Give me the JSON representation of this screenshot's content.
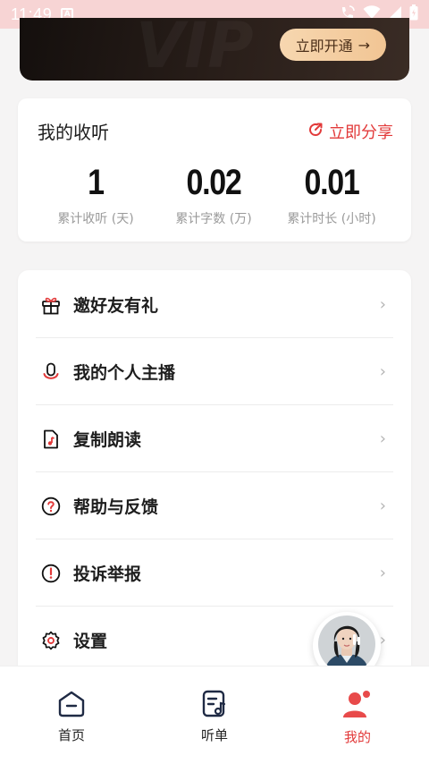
{
  "status_bar": {
    "time": "11:49",
    "notification_icon": "a-icon",
    "indicators": [
      "call-wifi-icon",
      "wifi-icon",
      "signal-icon",
      "battery-icon"
    ]
  },
  "vip_banner": {
    "button_label": "立即开通",
    "button_arrow": "→"
  },
  "listening": {
    "title": "我的收听",
    "share_label": "立即分享",
    "stats": [
      {
        "value": "1",
        "label": "累计收听 (天)"
      },
      {
        "value": "0.02",
        "label": "累计字数 (万)"
      },
      {
        "value": "0.01",
        "label": "累计时长 (小时)"
      }
    ]
  },
  "menu": {
    "items": [
      {
        "label": "邀好友有礼",
        "icon": "gift-icon"
      },
      {
        "label": "我的个人主播",
        "icon": "microphone-icon"
      },
      {
        "label": "复制朗读",
        "icon": "document-music-icon"
      },
      {
        "label": "帮助与反馈",
        "icon": "question-icon"
      },
      {
        "label": "投诉举报",
        "icon": "exclamation-icon"
      },
      {
        "label": "设置",
        "icon": "gear-icon"
      }
    ],
    "chevron": "›"
  },
  "tabbar": {
    "tabs": [
      {
        "label": "首页",
        "icon": "home-icon",
        "active": false
      },
      {
        "label": "听单",
        "icon": "playlist-icon",
        "active": false
      },
      {
        "label": "我的",
        "icon": "profile-icon",
        "active": true
      }
    ]
  },
  "colors": {
    "accent": "#e23a3a",
    "status_bar": "#f7d4d4",
    "banner_dark": "#1a1411",
    "vip_button": "#f3cc9e"
  }
}
